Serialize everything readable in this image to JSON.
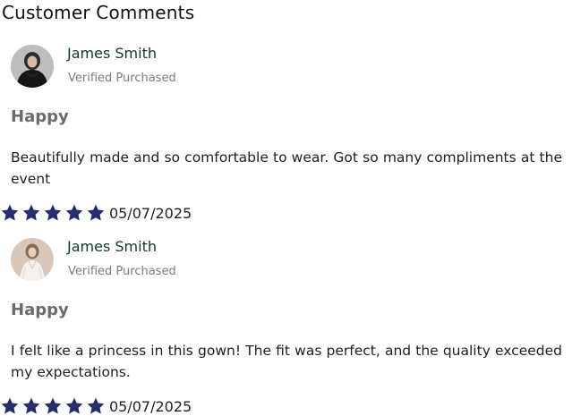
{
  "section": {
    "title": "Customer Comments"
  },
  "comments": [
    {
      "author": "James Smith",
      "verified_label": "Verified Purchased",
      "headline": "Happy",
      "body": "Beautifully made and so comfortable to wear. Got so many compliments at the event",
      "rating": 5,
      "date": "05/07/2025",
      "avatar_icon": "avatar-dark-outfit"
    },
    {
      "author": "James Smith",
      "verified_label": "Verified Purchased",
      "headline": "Happy",
      "body": "I felt like a princess in this gown! The fit was perfect, and the quality exceeded my expectations.",
      "rating": 5,
      "date": "05/07/2025",
      "avatar_icon": "avatar-white-outfit"
    }
  ],
  "colors": {
    "star": "#252b6e",
    "author": "#13362b",
    "headline": "#6b6b6b",
    "muted": "#7b7b7b"
  }
}
